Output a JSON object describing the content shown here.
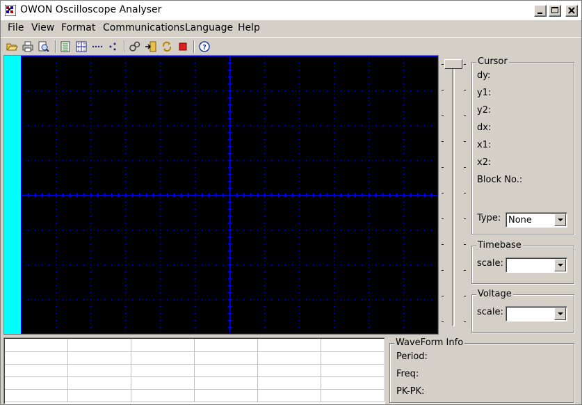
{
  "window": {
    "title": "OWON Oscilloscope Analyser",
    "app_icon": "oscilloscope-app-icon"
  },
  "menu": [
    "File",
    "View",
    "Format",
    "Communications",
    "Language",
    "Help"
  ],
  "toolbar": {
    "icons": [
      "open-folder-icon",
      "print-icon",
      "print-preview-icon",
      "list-view-icon",
      "grid-icon",
      "dotted-line-icon",
      "scatter-icon",
      "connect-icon",
      "import-icon",
      "refresh-icon",
      "stop-icon",
      "help-icon"
    ]
  },
  "colors": {
    "screen_background": "#000000",
    "grid_color": "#0000ff",
    "left_strip": "#00ffff"
  },
  "cursor_panel": {
    "title": "Cursor",
    "labels": [
      "dy:",
      "y1:",
      "y2:",
      "dx:",
      "x1:",
      "x2:",
      "Block No.:"
    ],
    "type_label": "Type:",
    "type_value": "None"
  },
  "timebase_panel": {
    "title": "Timebase",
    "scale_label": "scale:",
    "scale_value": ""
  },
  "voltage_panel": {
    "title": "Voltage",
    "scale_label": "scale:",
    "scale_value": ""
  },
  "waveform_info": {
    "title": "WaveForm Info",
    "labels": [
      "Period:",
      "Freq:",
      "PK-PK:"
    ]
  }
}
